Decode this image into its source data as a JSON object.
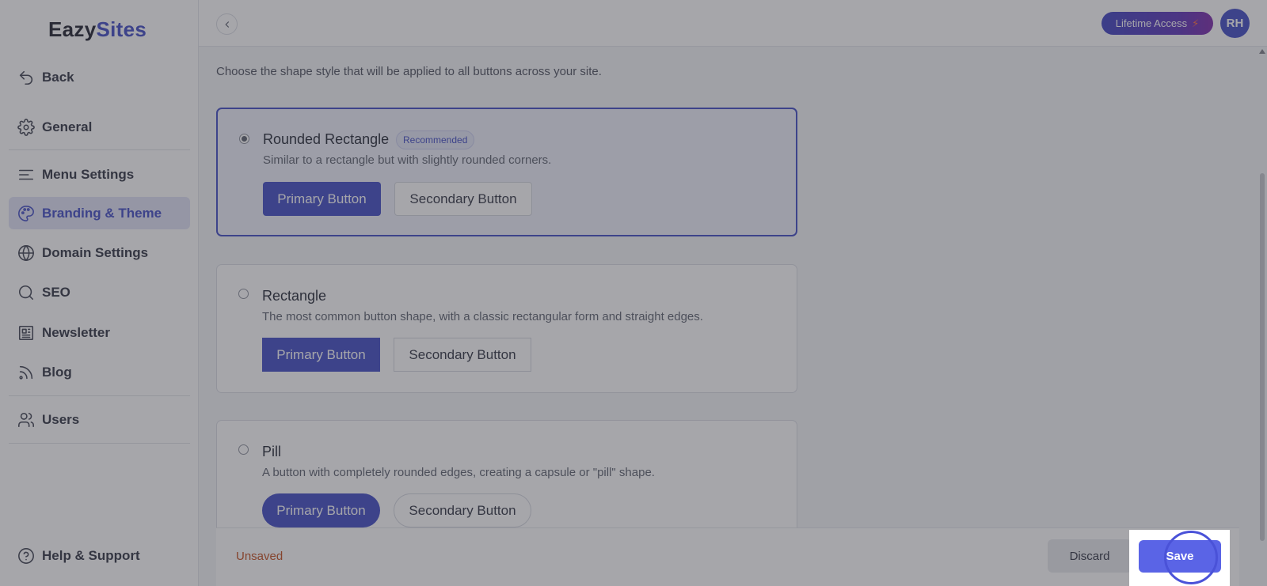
{
  "logo": {
    "part1": "Eazy",
    "part2": "Sites"
  },
  "sidebar": {
    "items": [
      {
        "label": "Back",
        "icon": "back-arrow-icon"
      },
      {
        "label": "General",
        "icon": "gear-icon"
      },
      {
        "label": "Menu Settings",
        "icon": "menu-lines-icon"
      },
      {
        "label": "Branding & Theme",
        "icon": "palette-icon"
      },
      {
        "label": "Domain Settings",
        "icon": "globe-icon"
      },
      {
        "label": "SEO",
        "icon": "search-icon"
      },
      {
        "label": "Newsletter",
        "icon": "newspaper-icon"
      },
      {
        "label": "Blog",
        "icon": "rss-icon"
      },
      {
        "label": "Users",
        "icon": "users-icon"
      },
      {
        "label": "Help & Support",
        "icon": "help-circle-icon"
      }
    ],
    "active": "Branding & Theme"
  },
  "topbar": {
    "lifetime_label": "Lifetime Access",
    "avatar_initials": "RH"
  },
  "main": {
    "description": "Choose the shape style that will be applied to all buttons across your site.",
    "options": [
      {
        "title": "Rounded Rectangle",
        "badge": "Recommended",
        "description": "Similar to a rectangle but with slightly rounded corners.",
        "primary": "Primary Button",
        "secondary": "Secondary Button",
        "selected": true
      },
      {
        "title": "Rectangle",
        "description": "The most common button shape, with a classic rectangular form and straight edges.",
        "primary": "Primary Button",
        "secondary": "Secondary Button",
        "selected": false
      },
      {
        "title": "Pill",
        "description": "A button with completely rounded edges, creating a capsule or \"pill\" shape.",
        "primary": "Primary Button",
        "secondary": "Secondary Button",
        "selected": false
      }
    ]
  },
  "footer": {
    "status": "Unsaved",
    "discard_label": "Discard",
    "save_label": "Save"
  },
  "colors": {
    "accent": "#3d48c4",
    "active_bg": "#dfe2f5",
    "save": "#5a64e6",
    "unsaved": "#c24b1a"
  }
}
